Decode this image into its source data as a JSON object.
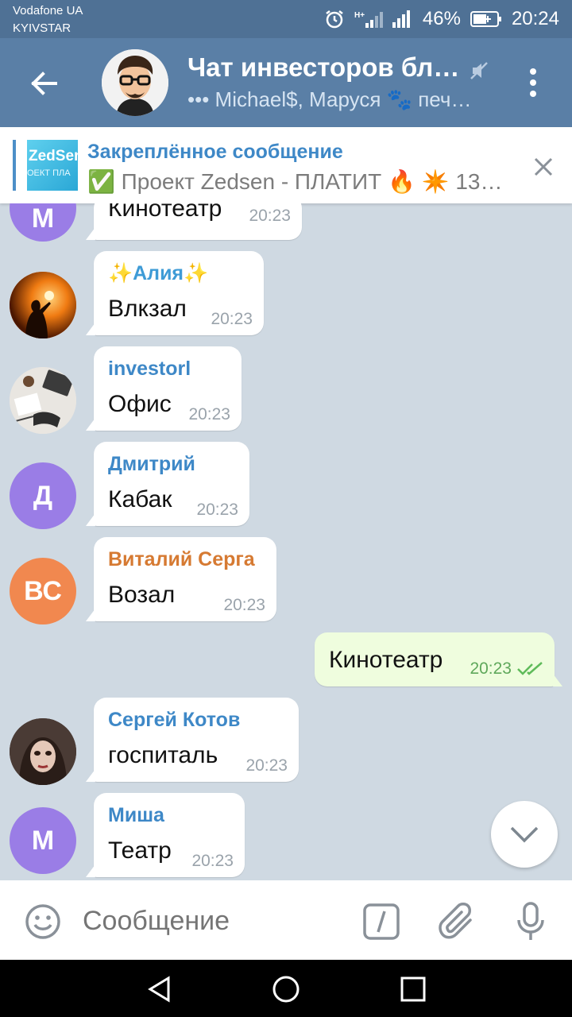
{
  "status_bar": {
    "carrier_line1": "Vodafone UA",
    "carrier_line2": "KYIVSTAR",
    "battery": "46%",
    "time": "20:24",
    "icons": [
      "alarm-icon",
      "hplus-signal-icon",
      "signal-icon",
      "battery-icon"
    ]
  },
  "header": {
    "title": "Чат инвесторов бл…",
    "subtitle_dots": "•••",
    "subtitle": "Michael$, Маруся 🐾 печ…",
    "muted": true
  },
  "pinned": {
    "title": "Закреплённое сообщение",
    "thumb_text": "ZedSen",
    "thumb_subtext": "ОЕКТ ПЛА",
    "text": "✅ Проект Zedsen - ПЛАТИТ 🔥 ✴️ 13…"
  },
  "messages": [
    {
      "sender": "",
      "text": "Кинотеатр",
      "time": "20:23",
      "avatar_letter": "М",
      "avatar_color": "#9a7de6"
    },
    {
      "sender": "✨Алия✨",
      "sender_color": "#3e9bd6",
      "text": "Влкзал",
      "time": "20:23"
    },
    {
      "sender": "investorl",
      "sender_color": "#3e88c7",
      "text": "Офис",
      "time": "20:23"
    },
    {
      "sender": "Дмитрий",
      "sender_color": "#3e88c7",
      "text": "Кабак",
      "time": "20:23",
      "avatar_letter": "Д",
      "avatar_color": "#9a7de6"
    },
    {
      "sender": "Виталий Серга",
      "sender_color": "#d67a32",
      "text": "Возал",
      "time": "20:23",
      "avatar_letter": "ВС",
      "avatar_color": "#f1884f"
    },
    {
      "sender": "",
      "text": "Кинотеатр",
      "time": "20:23",
      "outgoing": true
    },
    {
      "sender": "Сергей Котов",
      "sender_color": "#3e88c7",
      "text": "госпиталь",
      "time": "20:23"
    },
    {
      "sender": "Миша",
      "sender_color": "#3e88c7",
      "text": "Театр",
      "time": "20:23",
      "avatar_letter": "М",
      "avatar_color": "#9a7de6"
    }
  ],
  "input": {
    "placeholder": "Сообщение"
  }
}
